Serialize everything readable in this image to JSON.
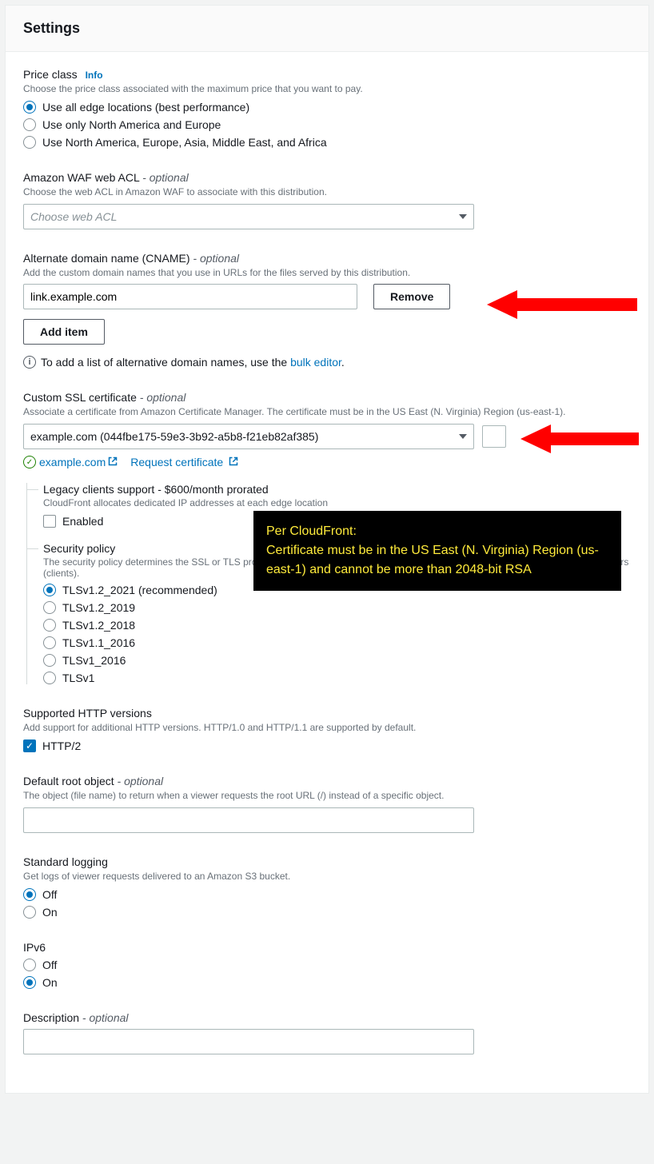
{
  "title": "Settings",
  "priceClass": {
    "label": "Price class",
    "info": "Info",
    "desc": "Choose the price class associated with the maximum price that you want to pay.",
    "options": [
      "Use all edge locations (best performance)",
      "Use only North America and Europe",
      "Use North America, Europe, Asia, Middle East, and Africa"
    ]
  },
  "waf": {
    "label": "Amazon WAF web ACL",
    "optional": "- optional",
    "desc": "Choose the web ACL in Amazon WAF to associate with this distribution.",
    "placeholder": "Choose web ACL"
  },
  "cname": {
    "label": "Alternate domain name (CNAME)",
    "optional": "- optional",
    "desc": "Add the custom domain names that you use in URLs for the files served by this distribution.",
    "value": "link.example.com",
    "remove": "Remove",
    "addItem": "Add item",
    "hint_prefix": "To add a list of alternative domain names, use the ",
    "hint_link": "bulk editor",
    "hint_suffix": "."
  },
  "ssl": {
    "label": "Custom SSL certificate",
    "optional": "- optional",
    "desc": "Associate a certificate from Amazon Certificate Manager. The certificate must be in the US East (N. Virginia) Region (us-east-1).",
    "selected": "example.com (044fbe175-59e3-3b92-a5b8-f21eb82af385)",
    "domain": "example.com",
    "request": "Request certificate"
  },
  "legacy": {
    "label": "Legacy clients support - $600/month prorated",
    "desc": "CloudFront allocates dedicated IP addresses at each edge location",
    "enabled": "Enabled"
  },
  "security": {
    "label": "Security policy",
    "desc": "The security policy determines the SSL or TLS protocol and the specific ciphers that CloudFront uses for HTTPS connections with viewers (clients).",
    "options": [
      "TLSv1.2_2021 (recommended)",
      "TLSv1.2_2019",
      "TLSv1.2_2018",
      "TLSv1.1_2016",
      "TLSv1_2016",
      "TLSv1"
    ]
  },
  "http": {
    "label": "Supported HTTP versions",
    "desc": "Add support for additional HTTP versions. HTTP/1.0 and HTTP/1.1 are supported by default.",
    "option": "HTTP/2"
  },
  "root": {
    "label": "Default root object",
    "optional": "- optional",
    "desc": "The object (file name) to return when a viewer requests the root URL (/) instead of a specific object."
  },
  "logging": {
    "label": "Standard logging",
    "desc": "Get logs of viewer requests delivered to an Amazon S3 bucket.",
    "off": "Off",
    "on": "On"
  },
  "ipv6": {
    "label": "IPv6",
    "off": "Off",
    "on": "On"
  },
  "descField": {
    "label": "Description",
    "optional": "- optional"
  },
  "callout": {
    "title": "Per CloudFront:",
    "body": "Certificate must be in the US East (N. Virginia) Region (us-east-1) and cannot be more than 2048-bit RSA"
  }
}
